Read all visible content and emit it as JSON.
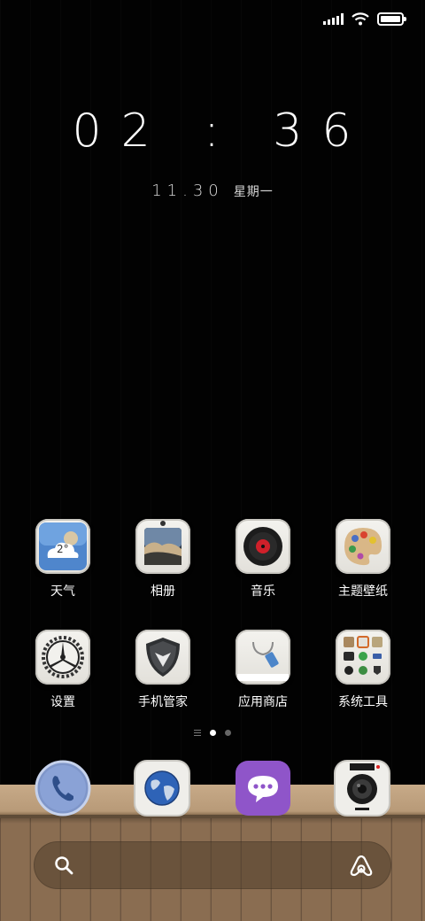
{
  "status_bar": {
    "signal_icon": "signal-strength-icon",
    "wifi_icon": "wifi-icon",
    "battery_icon": "battery-icon",
    "battery_level": 1.0
  },
  "lock_widget": {
    "time": "02:36",
    "date": "11.30",
    "weekday": "星期一"
  },
  "apps": [
    {
      "label": "天气",
      "icon": "weather-icon",
      "temp": "2°"
    },
    {
      "label": "相册",
      "icon": "gallery-icon"
    },
    {
      "label": "音乐",
      "icon": "music-icon"
    },
    {
      "label": "主题壁纸",
      "icon": "theme-palette-icon"
    },
    {
      "label": "设置",
      "icon": "settings-gear-icon"
    },
    {
      "label": "手机管家",
      "icon": "security-shield-icon"
    },
    {
      "label": "应用商店",
      "icon": "app-store-bag-icon"
    },
    {
      "label": "系统工具",
      "icon": "system-tools-folder-icon"
    }
  ],
  "pager": {
    "pages": 2,
    "current": 1,
    "menu_icon": "page-menu-icon"
  },
  "dock": [
    {
      "name": "phone",
      "icon": "phone-icon"
    },
    {
      "name": "browser",
      "icon": "globe-icon"
    },
    {
      "name": "messages",
      "icon": "message-bubble-icon"
    },
    {
      "name": "camera",
      "icon": "camera-icon"
    }
  ],
  "search": {
    "icon": "search-icon",
    "assistant_icon": "assistant-icon"
  },
  "colors": {
    "background": "#000000",
    "wood": "#8a6d51",
    "messages_purple": "#8f55c9",
    "weather_blue": "#4f86cc",
    "music_red": "#d0202a"
  }
}
